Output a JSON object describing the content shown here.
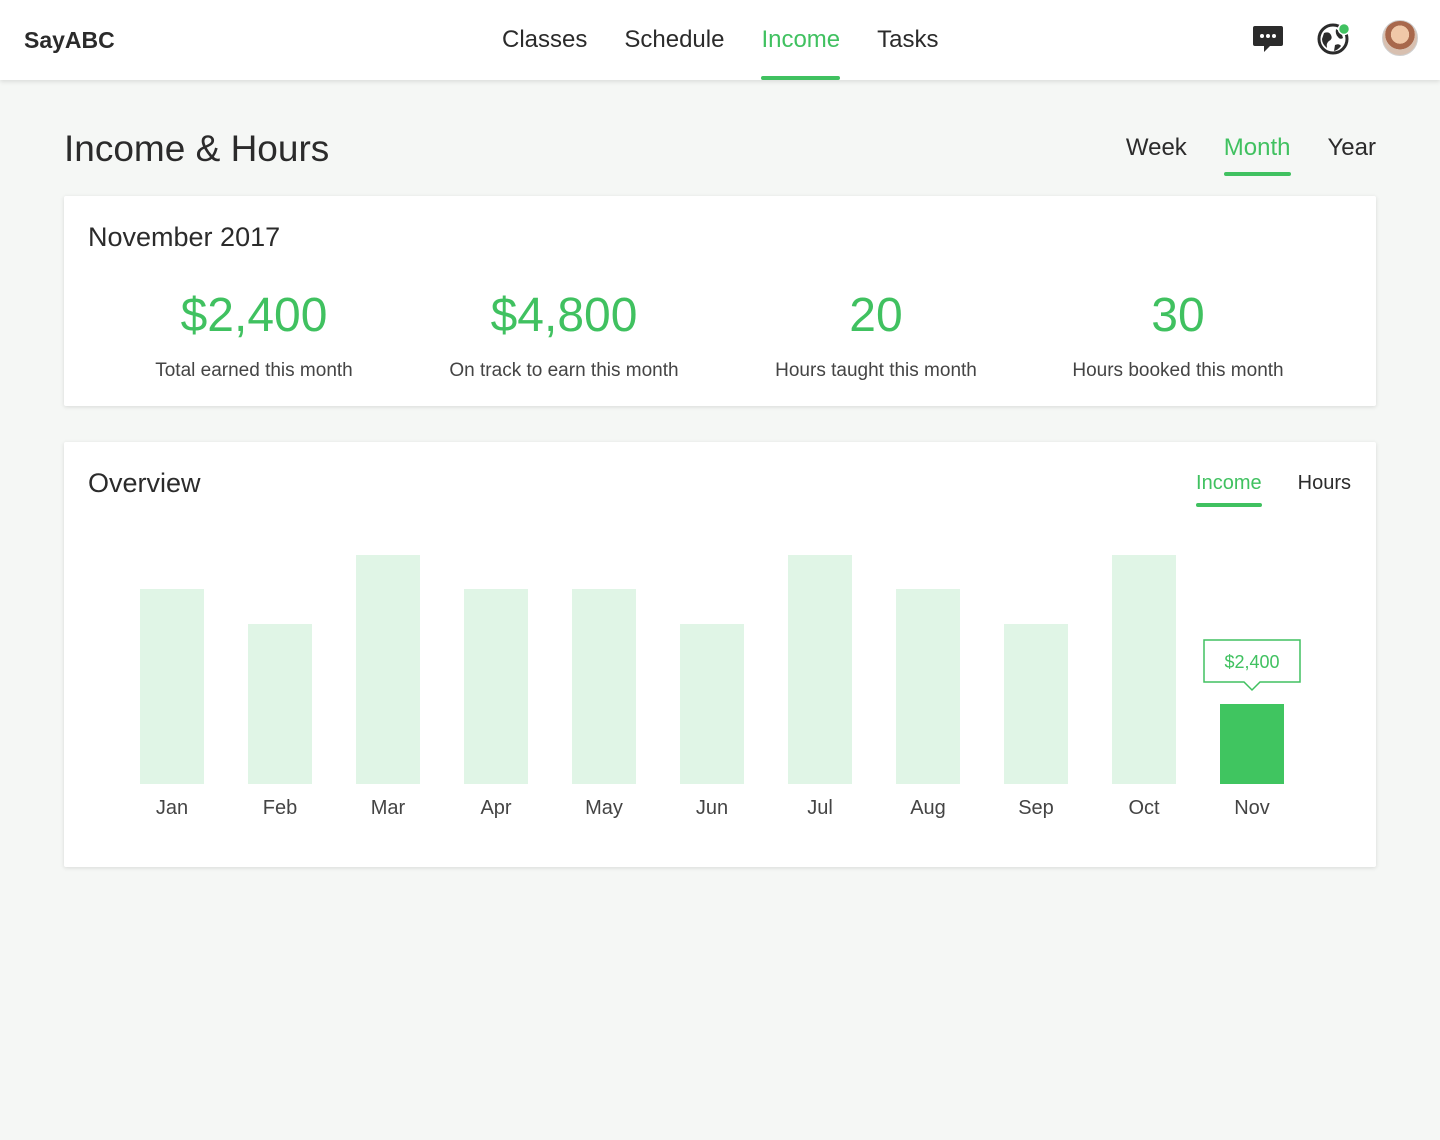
{
  "app": {
    "brand": "SayABC"
  },
  "nav": {
    "items": [
      {
        "label": "Classes",
        "active": false
      },
      {
        "label": "Schedule",
        "active": false
      },
      {
        "label": "Income",
        "active": true
      },
      {
        "label": "Tasks",
        "active": false
      }
    ]
  },
  "header_icons": [
    "chat-icon",
    "globe-icon",
    "avatar"
  ],
  "page": {
    "title": "Income & Hours"
  },
  "period_tabs": {
    "items": [
      {
        "label": "Week",
        "active": false
      },
      {
        "label": "Month",
        "active": true
      },
      {
        "label": "Year",
        "active": false
      }
    ]
  },
  "summary": {
    "title": "November 2017",
    "stats": [
      {
        "value": "$2,400",
        "label": "Total earned this month"
      },
      {
        "value": "$4,800",
        "label": "On track to earn this month"
      },
      {
        "value": "20",
        "label": "Hours taught this month"
      },
      {
        "value": "30",
        "label": "Hours booked this month"
      }
    ]
  },
  "overview": {
    "title": "Overview",
    "tabs": [
      {
        "label": "Income",
        "active": true
      },
      {
        "label": "Hours",
        "active": false
      }
    ],
    "tooltip": "$2,400"
  },
  "colors": {
    "accent": "#40c160",
    "bar_light": "#e0f5e6",
    "bar_current": "#40c560"
  },
  "chart_data": {
    "type": "bar",
    "categories": [
      "Jan",
      "Feb",
      "Mar",
      "Apr",
      "May",
      "Jun",
      "Jul",
      "Aug",
      "Sep",
      "Oct",
      "Nov"
    ],
    "values": [
      0.85,
      0.7,
      1.0,
      0.85,
      0.85,
      0.7,
      1.0,
      0.85,
      0.7,
      1.0,
      0.35
    ],
    "highlighted": "Nov",
    "highlight_label": "$2,400",
    "title": "Overview",
    "grid": false
  }
}
